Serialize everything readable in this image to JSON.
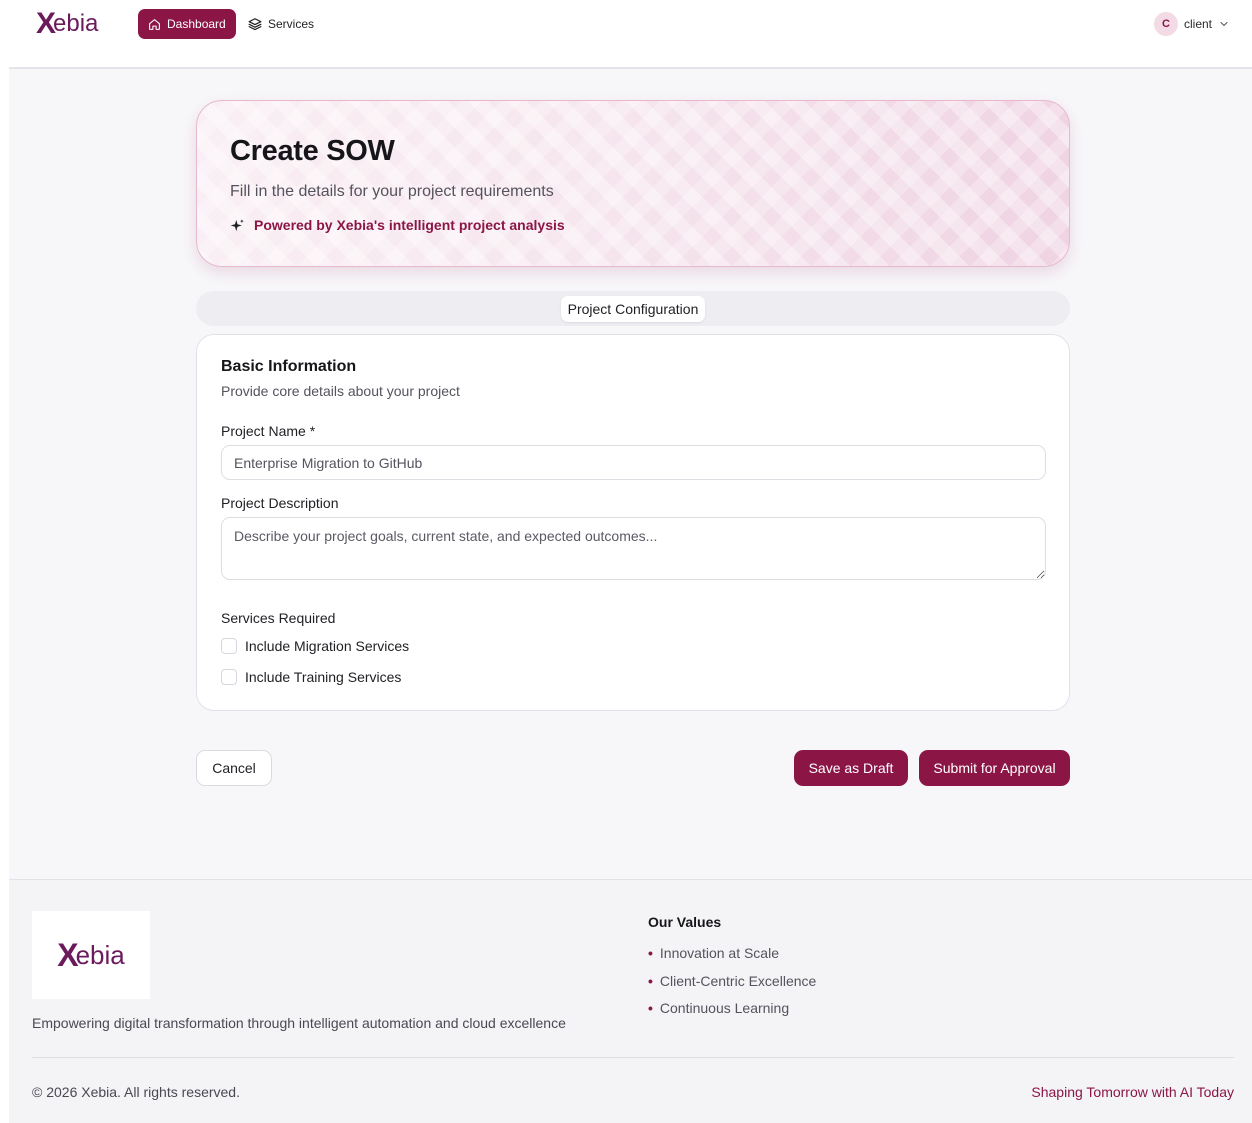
{
  "header": {
    "logo_mark": "X",
    "logo_text": "ebia",
    "nav": [
      {
        "label": "Dashboard",
        "icon": "home-icon",
        "active": true
      },
      {
        "label": "Services",
        "icon": "layers-icon",
        "active": false
      }
    ],
    "user": {
      "initial": "C",
      "name": "client"
    }
  },
  "hero": {
    "title": "Create SOW",
    "subtitle": "Fill in the details for your project requirements",
    "powered_by": "Powered by Xebia's intelligent project analysis"
  },
  "tabs": [
    {
      "label": "Project Configuration",
      "active": true
    }
  ],
  "form": {
    "title": "Basic Information",
    "subtitle": "Provide core details about your project",
    "project_name_label": "Project Name *",
    "project_name_value": "Enterprise Migration to GitHub",
    "description_label": "Project Description",
    "description_placeholder": "Describe your project goals, current state, and expected outcomes...",
    "services_label": "Services Required",
    "services": [
      {
        "label": "Include Migration Services",
        "checked": false
      },
      {
        "label": "Include Training Services",
        "checked": false
      }
    ]
  },
  "actions": {
    "cancel": "Cancel",
    "save_draft": "Save as Draft",
    "submit": "Submit for Approval"
  },
  "footer": {
    "logo_mark": "X",
    "logo_text": "ebia",
    "tagline": "Empowering digital transformation through intelligent automation and cloud excellence",
    "values_title": "Our Values",
    "values": [
      "Innovation at Scale",
      "Client-Centric Excellence",
      "Continuous Learning"
    ],
    "copyright": "© 2026 Xebia. All rights reserved.",
    "slogan": "Shaping Tomorrow with AI Today"
  },
  "colors": {
    "brand": "#8b1646",
    "logo": "#6b1a5c",
    "background": "#f7f6f9"
  }
}
